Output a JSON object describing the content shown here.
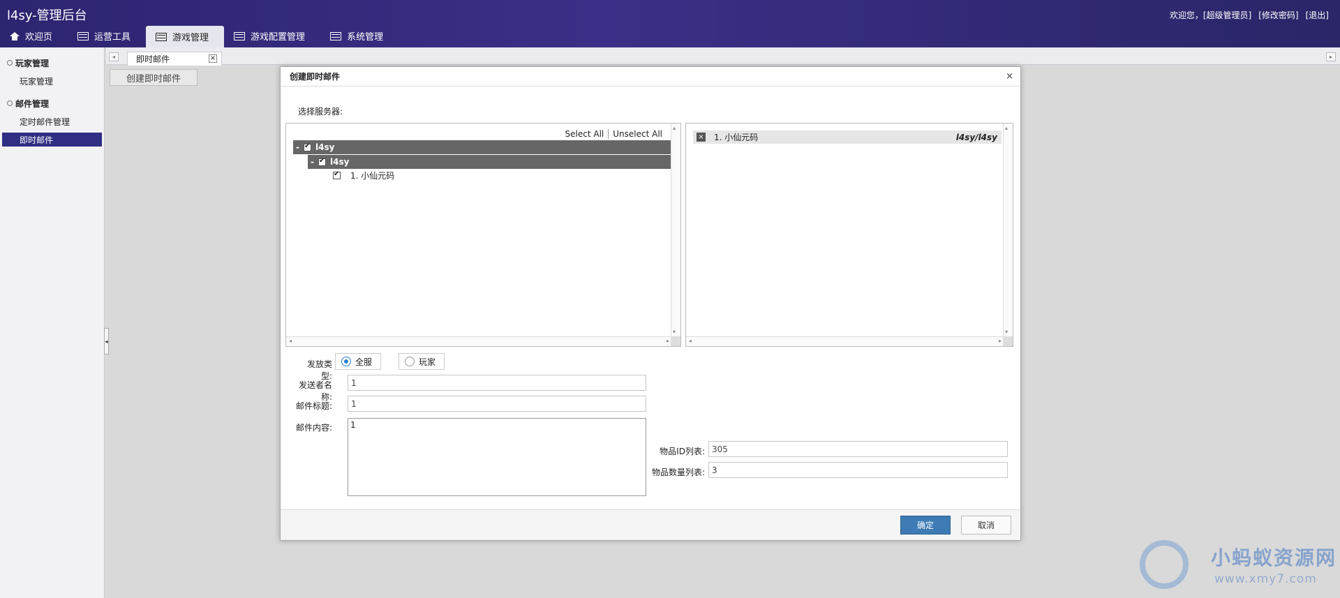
{
  "app": {
    "title": "l4sy-管理后台"
  },
  "header_links": [
    "欢迎您，[超级管理员]",
    "[修改密码]",
    "[退出]"
  ],
  "nav": [
    {
      "label": "欢迎页",
      "icon": "home-icon"
    },
    {
      "label": "运营工具",
      "icon": "list-icon"
    },
    {
      "label": "游戏管理",
      "icon": "list-icon",
      "active": true
    },
    {
      "label": "游戏配置管理",
      "icon": "list-icon"
    },
    {
      "label": "系统管理",
      "icon": "list-icon"
    }
  ],
  "sidebar": {
    "groups": [
      {
        "title": "玩家管理",
        "items": [
          {
            "label": "玩家管理"
          }
        ]
      },
      {
        "title": "邮件管理",
        "items": [
          {
            "label": "定时邮件管理"
          },
          {
            "label": "即时邮件",
            "active": true
          }
        ]
      }
    ]
  },
  "tabs": {
    "open": "即时邮件",
    "close": "×",
    "left_arrow": "◂",
    "right_arrow": "▸"
  },
  "toolbar": {
    "create_label": "创建即时邮件"
  },
  "modal": {
    "title": "创建即时邮件",
    "close": "×",
    "server_label": "选择服务器:",
    "select_all": "Select All",
    "unselect_all": "Unselect All",
    "tree": {
      "level1": "l4sy",
      "level2": "l4sy",
      "leaf": "1. 小仙元码",
      "collapse": "-"
    },
    "selected": {
      "name": "1. 小仙元码",
      "path": "l4sy/l4sy",
      "remove": "×"
    },
    "form": {
      "type_label": "发放类型:",
      "type_options": [
        "全服",
        "玩家"
      ],
      "sender_label": "发送者名称:",
      "sender_value": "1",
      "subject_label": "邮件标题:",
      "subject_value": "1",
      "content_label": "邮件内容:",
      "content_value": "1",
      "item_ids_label": "物品ID列表:",
      "item_ids_value": "305",
      "item_counts_label": "物品数量列表:",
      "item_counts_value": "3"
    },
    "ok_label": "确定",
    "cancel_label": "取消"
  },
  "watermark": {
    "text": "小蚂蚁资源网",
    "url": "www.xmy7.com"
  },
  "colors": {
    "header": "#2c2570",
    "active_sidebar": "#2f2e83",
    "primary_button": "#3e7bb5"
  }
}
